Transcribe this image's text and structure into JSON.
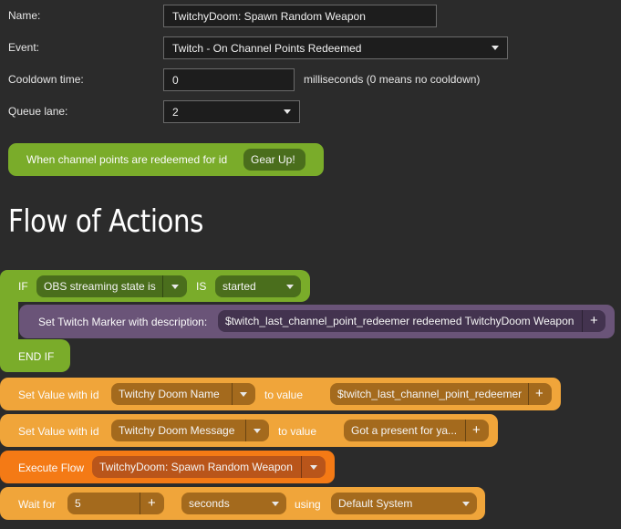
{
  "form": {
    "name_label": "Name:",
    "name_value": "TwitchyDoom: Spawn Random Weapon",
    "event_label": "Event:",
    "event_value": "Twitch - On Channel Points Redeemed",
    "cooldown_label": "Cooldown time:",
    "cooldown_value": "0",
    "cooldown_hint": "milliseconds (0 means no cooldown)",
    "queue_label": "Queue lane:",
    "queue_value": "2"
  },
  "trigger": {
    "text": "When channel points are redeemed for id",
    "id_value": "Gear Up!"
  },
  "section_title": "Flow of Actions",
  "if_block": {
    "if_label": "IF",
    "condition": "OBS streaming state is",
    "is_label": "IS",
    "state_value": "started",
    "end_label": "END IF",
    "inner": {
      "label": "Set Twitch Marker with description:",
      "value": "$twitch_last_channel_point_redeemer redeemed TwitchyDoom Weapon",
      "plus": "+"
    }
  },
  "actions": [
    {
      "label": "Set Value with id",
      "id_value": "Twitchy Doom Name",
      "to_label": "to value",
      "value": "$twitch_last_channel_point_redeemer",
      "plus": "+"
    },
    {
      "label": "Set Value with id",
      "id_value": "Twitchy Doom Message",
      "to_label": "to value",
      "value": "Got a present for ya...",
      "plus": "+"
    }
  ],
  "execute": {
    "label": "Execute Flow",
    "flow_value": "TwitchyDoom: Spawn Random Weapon"
  },
  "wait": {
    "label": "Wait for",
    "amount": "5",
    "plus": "+",
    "unit": "seconds",
    "using_label": "using",
    "system": "Default System"
  },
  "colors": {
    "green": "#7aac2a",
    "purple": "#6a5478",
    "orange": "#f0a53a",
    "dark_orange": "#f47a15",
    "background": "#2b2b2b"
  }
}
